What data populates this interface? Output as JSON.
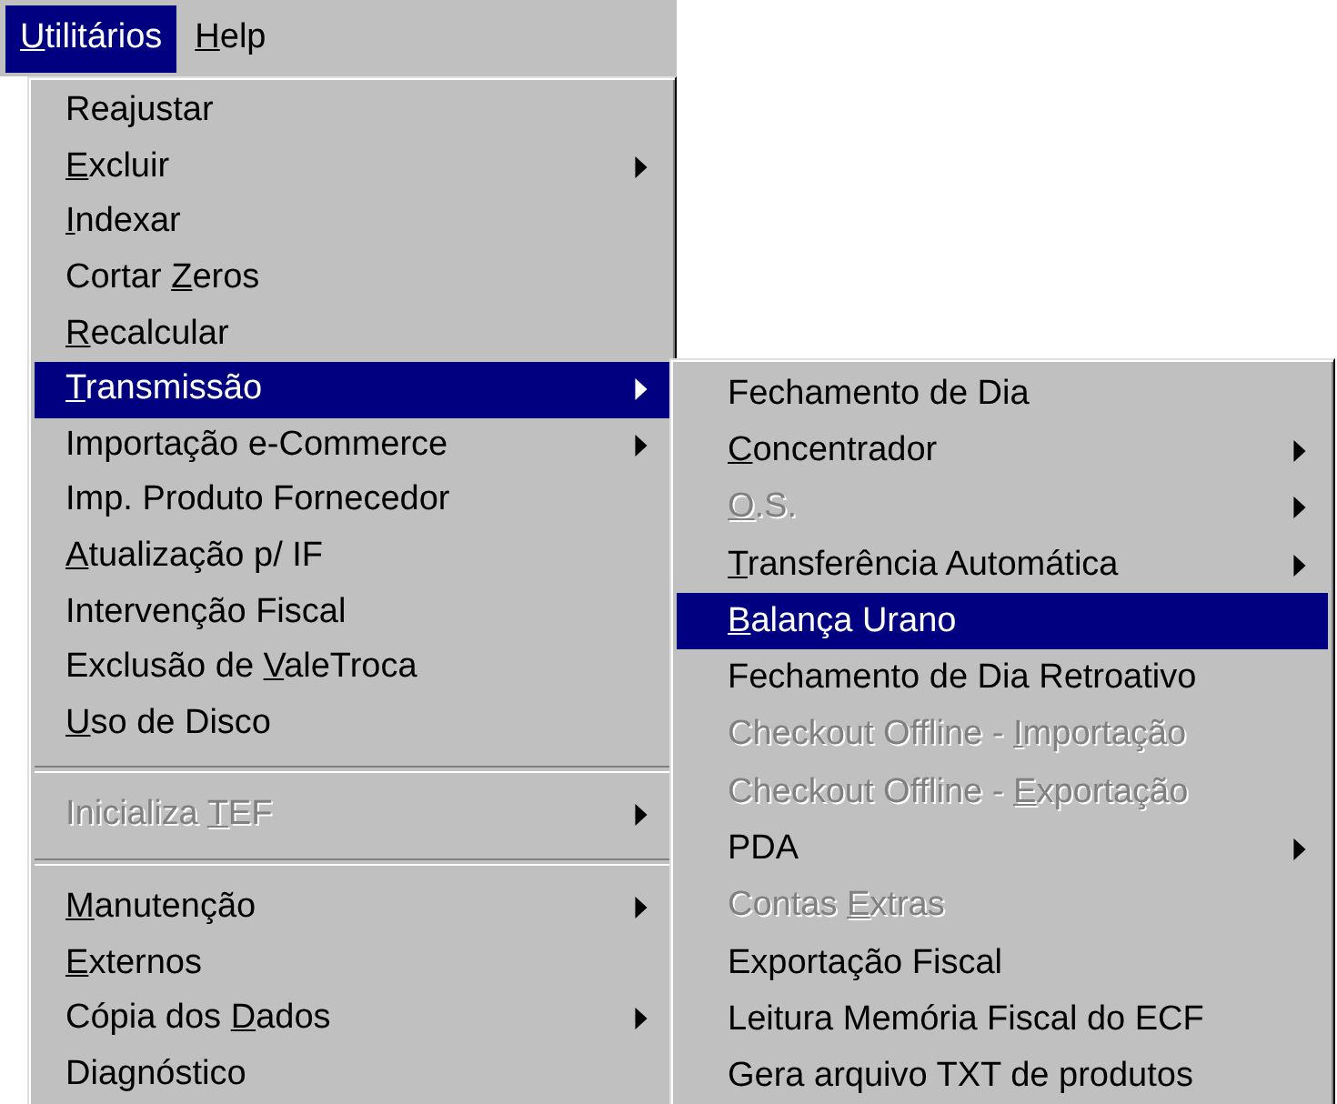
{
  "menu_bar": {
    "items": [
      {
        "label": {
          "key": "U",
          "after": "tilitários"
        },
        "selected": true
      },
      {
        "label": {
          "key": "H",
          "after": "elp"
        },
        "selected": false
      }
    ]
  },
  "menu": {
    "items": [
      {
        "kind": "item",
        "label": {
          "before": "Reajustar"
        },
        "has_submenu": false,
        "disabled": false,
        "selected": false
      },
      {
        "kind": "item",
        "label": {
          "key": "E",
          "after": "xcluir"
        },
        "has_submenu": true,
        "disabled": false,
        "selected": false
      },
      {
        "kind": "item",
        "label": {
          "key": "I",
          "after": "ndexar"
        },
        "has_submenu": false,
        "disabled": false,
        "selected": false
      },
      {
        "kind": "item",
        "label": {
          "before": "Cortar ",
          "key": "Z",
          "after": "eros"
        },
        "has_submenu": false,
        "disabled": false,
        "selected": false
      },
      {
        "kind": "item",
        "label": {
          "key": "R",
          "after": "ecalcular"
        },
        "has_submenu": false,
        "disabled": false,
        "selected": false
      },
      {
        "kind": "item",
        "label": {
          "key": "T",
          "after": "ransmissão"
        },
        "has_submenu": true,
        "disabled": false,
        "selected": true
      },
      {
        "kind": "item",
        "label": {
          "before": "Importação e-Commerce"
        },
        "has_submenu": true,
        "disabled": false,
        "selected": false
      },
      {
        "kind": "item",
        "label": {
          "before": "Imp. Produto Fornecedor"
        },
        "has_submenu": false,
        "disabled": false,
        "selected": false
      },
      {
        "kind": "item",
        "label": {
          "key": "A",
          "after": "tualização p/ IF"
        },
        "has_submenu": false,
        "disabled": false,
        "selected": false
      },
      {
        "kind": "item",
        "label": {
          "before": "Intervenção Fiscal"
        },
        "has_submenu": false,
        "disabled": false,
        "selected": false
      },
      {
        "kind": "item",
        "label": {
          "before": "Exclusão de ",
          "key": "V",
          "after": "aleTroca"
        },
        "has_submenu": false,
        "disabled": false,
        "selected": false
      },
      {
        "kind": "item",
        "label": {
          "key": "U",
          "after": "so de Disco"
        },
        "has_submenu": false,
        "disabled": false,
        "selected": false
      },
      {
        "kind": "separator"
      },
      {
        "kind": "item",
        "label": {
          "before": "Inicializa ",
          "key": "T",
          "after": "EF"
        },
        "has_submenu": true,
        "disabled": true,
        "selected": false
      },
      {
        "kind": "separator"
      },
      {
        "kind": "item",
        "label": {
          "key": "M",
          "after": "anutenção"
        },
        "has_submenu": true,
        "disabled": false,
        "selected": false
      },
      {
        "kind": "item",
        "label": {
          "key": "E",
          "after": "xternos"
        },
        "has_submenu": false,
        "disabled": false,
        "selected": false
      },
      {
        "kind": "item",
        "label": {
          "before": "Cópia dos ",
          "key": "D",
          "after": "ados"
        },
        "has_submenu": true,
        "disabled": false,
        "selected": false
      },
      {
        "kind": "item",
        "label": {
          "before": "Diagnóstico"
        },
        "has_submenu": false,
        "disabled": false,
        "selected": false
      }
    ]
  },
  "submenu": {
    "items": [
      {
        "kind": "item",
        "label": {
          "before": "Fechamento de Dia"
        },
        "has_submenu": false,
        "disabled": false,
        "selected": false
      },
      {
        "kind": "item",
        "label": {
          "key": "C",
          "after": "oncentrador"
        },
        "has_submenu": true,
        "disabled": false,
        "selected": false
      },
      {
        "kind": "item",
        "label": {
          "key": "O",
          "after": ".S."
        },
        "has_submenu": true,
        "disabled": true,
        "selected": false
      },
      {
        "kind": "item",
        "label": {
          "key": "T",
          "after": "ransferência Automática"
        },
        "has_submenu": true,
        "disabled": false,
        "selected": false
      },
      {
        "kind": "item",
        "label": {
          "key": "B",
          "after": "alança Urano"
        },
        "has_submenu": false,
        "disabled": false,
        "selected": true
      },
      {
        "kind": "item",
        "label": {
          "before": "Fechamento de Dia Retroativo"
        },
        "has_submenu": false,
        "disabled": false,
        "selected": false
      },
      {
        "kind": "item",
        "label": {
          "before": "Checkout Offline - ",
          "key": "I",
          "after": "mportação"
        },
        "has_submenu": false,
        "disabled": true,
        "selected": false
      },
      {
        "kind": "item",
        "label": {
          "before": "Checkout Offline - ",
          "key": "E",
          "after": "xportação"
        },
        "has_submenu": false,
        "disabled": true,
        "selected": false
      },
      {
        "kind": "item",
        "label": {
          "before": "PDA"
        },
        "has_submenu": true,
        "disabled": false,
        "selected": false
      },
      {
        "kind": "item",
        "label": {
          "before": "Contas ",
          "key": "E",
          "after": "xtras"
        },
        "has_submenu": false,
        "disabled": true,
        "selected": false
      },
      {
        "kind": "item",
        "label": {
          "before": "Exportação Fiscal"
        },
        "has_submenu": false,
        "disabled": false,
        "selected": false
      },
      {
        "kind": "item",
        "label": {
          "before": "Leitura Memória Fiscal do ECF"
        },
        "has_submenu": false,
        "disabled": false,
        "selected": false
      },
      {
        "kind": "item",
        "label": {
          "before": "Gera arquivo TXT de produtos"
        },
        "has_submenu": false,
        "disabled": false,
        "selected": false
      }
    ]
  }
}
